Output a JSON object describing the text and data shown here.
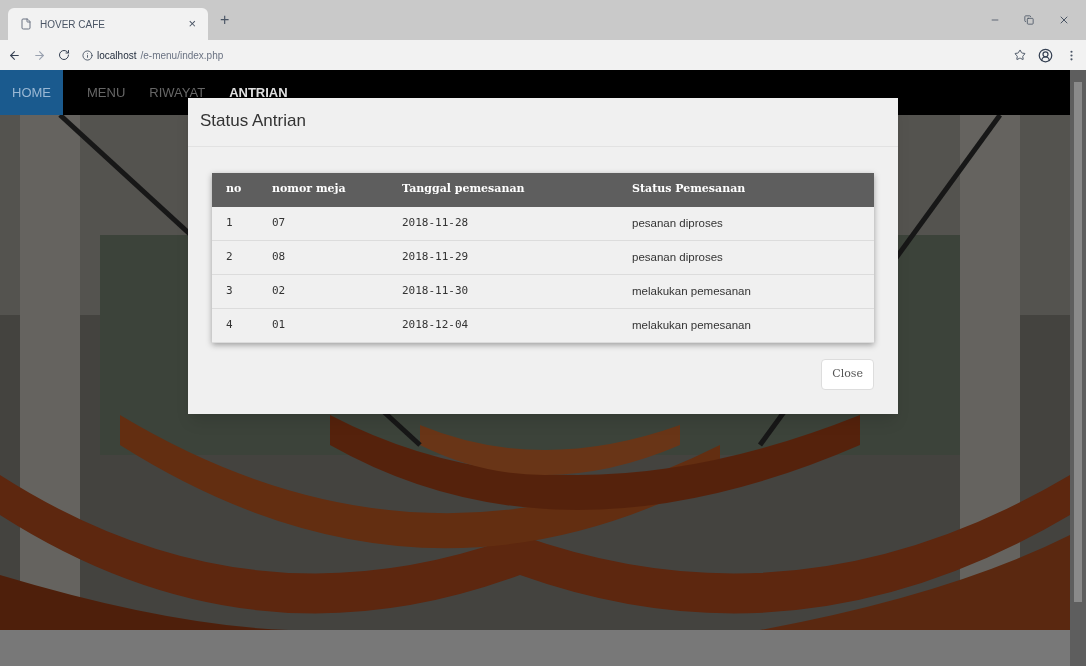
{
  "browser": {
    "tab_title": "HOVER CAFE",
    "tab_close": "×",
    "new_tab": "+",
    "url_host": "localhost",
    "url_path": "/e-menu/index.php"
  },
  "navbar": {
    "items": [
      {
        "label": "HOME",
        "selected": true,
        "highlighted": false
      },
      {
        "label": "MENU",
        "selected": false,
        "highlighted": false
      },
      {
        "label": "RIWAYAT",
        "selected": false,
        "highlighted": false
      },
      {
        "label": "ANTRIAN",
        "selected": false,
        "highlighted": true
      }
    ]
  },
  "modal": {
    "title": "Status Antrian",
    "table": {
      "columns": [
        "no",
        "nomor meja",
        "Tanggal pemesanan",
        "Status Pemesanan"
      ],
      "rows": [
        [
          "1",
          "07",
          "2018-11-28",
          "pesanan diproses"
        ],
        [
          "2",
          "08",
          "2018-11-29",
          "pesanan diproses"
        ],
        [
          "3",
          "02",
          "2018-11-30",
          "melakukan pemesanan"
        ],
        [
          "4",
          "01",
          "2018-12-04",
          "melakukan pemesanan"
        ]
      ]
    },
    "close_button": "Close"
  }
}
